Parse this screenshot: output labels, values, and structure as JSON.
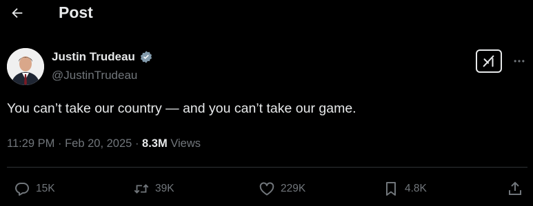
{
  "header": {
    "title": "Post"
  },
  "author": {
    "name": "Justin Trudeau",
    "handle": "@JustinTrudeau"
  },
  "post": {
    "text": "You can’t take our country — and you can’t take our game.",
    "time": "11:29 PM",
    "date": "Feb 20, 2025",
    "separator": "·",
    "views_count": "8.3M",
    "views_label": "Views"
  },
  "actions": {
    "replies": "15K",
    "reposts": "39K",
    "likes": "229K",
    "bookmarks": "4.8K"
  },
  "colors": {
    "background": "#000000",
    "text": "#e7e9ea",
    "muted": "#71767b",
    "verified": "#829aab",
    "divider": "#2f3336"
  },
  "icons": [
    "back-arrow-icon",
    "verified-badge-icon",
    "grok-icon",
    "more-icon",
    "reply-icon",
    "repost-icon",
    "like-icon",
    "bookmark-icon",
    "share-icon"
  ]
}
